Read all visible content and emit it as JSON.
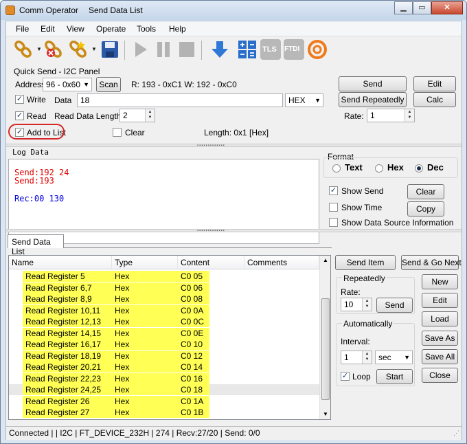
{
  "window": {
    "app_name": "Comm Operator",
    "document_title": "Send Data List"
  },
  "menu": [
    "File",
    "Edit",
    "View",
    "Operate",
    "Tools",
    "Help"
  ],
  "toolbar": {
    "icons": [
      "connect-icon",
      "disconnect-icon",
      "new-connection-icon",
      "save-icon",
      "play-icon",
      "pause-icon",
      "stop-icon",
      "download-icon",
      "calculator-icon",
      "tls-icon",
      "ftdi-icon",
      "protocol-icon"
    ],
    "tls_label": "TLS",
    "ftdi_label": "FTDI"
  },
  "quick_send": {
    "panel_title": "Quick Send - I2C Panel",
    "address_label": "Address",
    "address_value": "96 - 0x60",
    "scan_label": "Scan",
    "rw_info": "R: 193 - 0xC1  W: 192 - 0xC0",
    "write_label": "Write",
    "write_checked": true,
    "data_label": "Data",
    "data_value": "18",
    "format_value": "HEX",
    "read_label": "Read",
    "read_checked": true,
    "read_length_label": "Read Data Length",
    "read_length_value": "2",
    "add_to_list_label": "Add to List",
    "add_to_list_checked": true,
    "clear_label": "Clear",
    "clear_checked": false,
    "length_info": "Length: 0x1 [Hex]",
    "send_label": "Send",
    "edit_label": "Edit",
    "send_repeatedly_label": "Send Repeatedly",
    "calc_label": "Calc",
    "rate_label": "Rate:",
    "rate_value": "1"
  },
  "log": {
    "title": "Log Data",
    "lines": [
      {
        "text": "Send:192 24",
        "color": "#e00000"
      },
      {
        "text": "Send:193",
        "color": "#e00000"
      },
      {
        "text": "",
        "color": "#000000"
      },
      {
        "text": "Rec:00 130",
        "color": "#0000e0"
      }
    ]
  },
  "format": {
    "title": "Format",
    "options": [
      "Text",
      "Hex",
      "Dec"
    ],
    "selected": "Dec",
    "show_send_label": "Show Send",
    "show_send_checked": true,
    "show_time_label": "Show Time",
    "show_time_checked": false,
    "show_source_label": "Show Data Source Information",
    "show_source_checked": false,
    "clear_label": "Clear",
    "copy_label": "Copy"
  },
  "send_list": {
    "tab_label": "Send Data List",
    "columns": [
      "Name",
      "Type",
      "Content",
      "Comments"
    ],
    "rows": [
      {
        "name": "Read Register 5",
        "type": "Hex",
        "content": "C0 05"
      },
      {
        "name": "Read Register 6,7",
        "type": "Hex",
        "content": "C0 06"
      },
      {
        "name": "Read Register 8,9",
        "type": "Hex",
        "content": "C0 08"
      },
      {
        "name": "Read Register 10,11",
        "type": "Hex",
        "content": "C0 0A"
      },
      {
        "name": "Read Register 12,13",
        "type": "Hex",
        "content": "C0 0C"
      },
      {
        "name": "Read Register 14,15",
        "type": "Hex",
        "content": "C0 0E"
      },
      {
        "name": "Read Register 16,17",
        "type": "Hex",
        "content": "C0 10"
      },
      {
        "name": "Read Register 18,19",
        "type": "Hex",
        "content": "C0 12"
      },
      {
        "name": "Read Register 20,21",
        "type": "Hex",
        "content": "C0 14"
      },
      {
        "name": "Read Register 22,23",
        "type": "Hex",
        "content": "C0 16"
      },
      {
        "name": "Read Register 24,25",
        "type": "Hex",
        "content": "C0 18"
      },
      {
        "name": "Read Register 26",
        "type": "Hex",
        "content": "C0 1A"
      },
      {
        "name": "Read Register 27",
        "type": "Hex",
        "content": "C0 1B"
      }
    ],
    "send_item_label": "Send Item",
    "send_go_next_label": "Send & Go Next",
    "repeatedly_title": "Repeatedly",
    "rate_label": "Rate:",
    "rate_value": "10",
    "rep_send_label": "Send",
    "automatically_title": "Automatically",
    "interval_label": "Interval:",
    "interval_value": "1",
    "interval_unit": "sec",
    "loop_label": "Loop",
    "loop_checked": true,
    "start_label": "Start",
    "new_label": "New",
    "edit_label": "Edit",
    "load_label": "Load",
    "save_as_label": "Save As",
    "save_all_label": "Save All",
    "close_label": "Close"
  },
  "status_bar": "Connected |  | I2C | FT_DEVICE_232H | 274 | Recv:27/20 | Send: 0/0",
  "colors": {
    "highlight": "#ffff55",
    "send_text": "#e00000",
    "recv_text": "#0000e0",
    "annotation": "#d42a2a"
  }
}
